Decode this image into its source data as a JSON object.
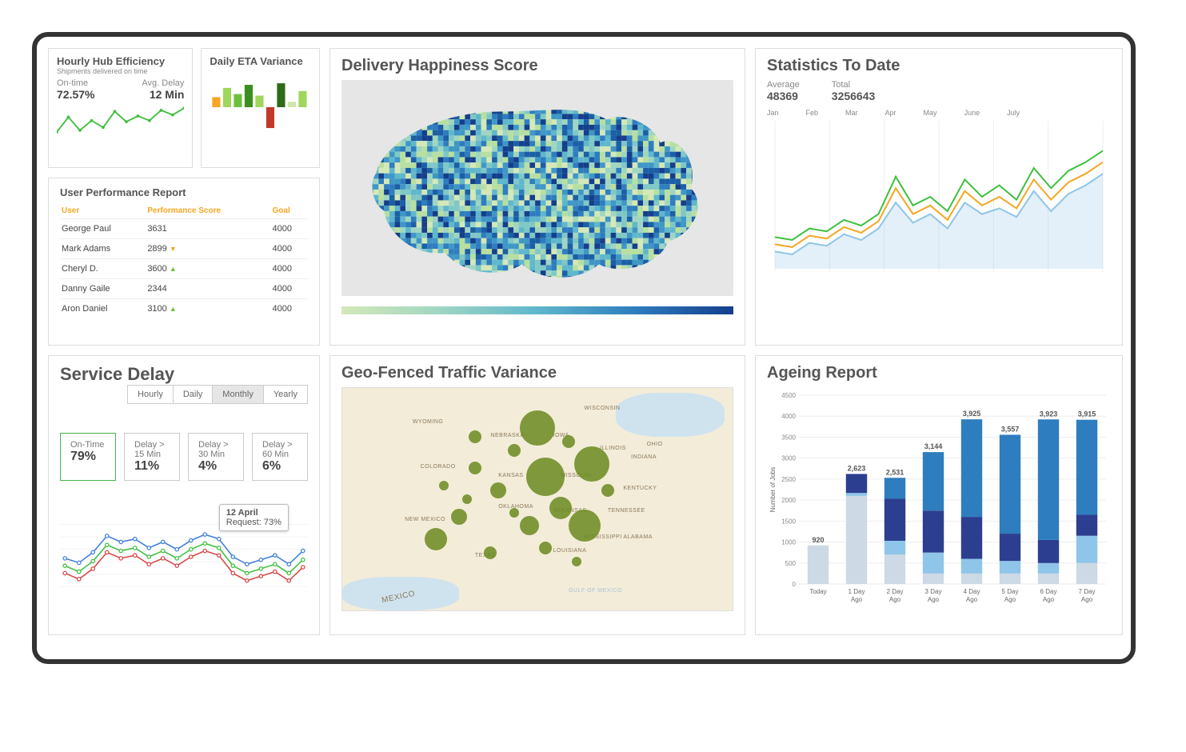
{
  "hub_efficiency": {
    "title": "Hourly Hub Efficiency",
    "subtitle": "Shipments delivered on time",
    "on_time_label": "On-time",
    "on_time_value": "72.57%",
    "avg_delay_label": "Avg. Delay",
    "avg_delay_value": "12 Min"
  },
  "eta_variance": {
    "title": "Daily ETA Variance"
  },
  "performance": {
    "title": "User Performance Report",
    "headers": {
      "user": "User",
      "score": "Performance Score",
      "goal": "Goal"
    },
    "rows": [
      {
        "user": "George Paul",
        "score": "3631",
        "trend": "",
        "goal": "4000"
      },
      {
        "user": "Mark Adams",
        "score": "2899",
        "trend": "down",
        "goal": "4000"
      },
      {
        "user": "Cheryl D.",
        "score": "3600",
        "trend": "up",
        "goal": "4000"
      },
      {
        "user": "Danny Gaile",
        "score": "2344",
        "trend": "",
        "goal": "4000"
      },
      {
        "user": "Aron Daniel",
        "score": "3100",
        "trend": "up",
        "goal": "4000"
      }
    ]
  },
  "happiness": {
    "title": "Delivery Happiness Score"
  },
  "statistics": {
    "title": "Statistics To Date",
    "avg_label": "Average",
    "avg_value": "48369",
    "total_label": "Total",
    "total_value": "3256643",
    "months": [
      "Jan",
      "Feb",
      "Mar",
      "Apr",
      "May",
      "June",
      "July"
    ]
  },
  "service_delay": {
    "title": "Service Delay",
    "tabs": [
      "Hourly",
      "Daily",
      "Monthly",
      "Yearly"
    ],
    "active_tab": "Monthly",
    "cards": [
      {
        "label": "On-Time",
        "value": "79%",
        "active": true
      },
      {
        "label": "Delay > 15 Min",
        "value": "11%"
      },
      {
        "label": "Delay > 30 Min",
        "value": "4%"
      },
      {
        "label": "Delay > 60 Min",
        "value": "6%"
      }
    ],
    "tooltip": {
      "title": "12 April",
      "sub": "Request: 73%"
    }
  },
  "geo": {
    "title": "Geo-Fenced Traffic Variance"
  },
  "ageing": {
    "title": "Ageing Report",
    "ylabel": "Number of Jobs"
  },
  "chart_data": [
    {
      "id": "hub_sparkline",
      "type": "line",
      "values": [
        52,
        78,
        55,
        72,
        60,
        88,
        70,
        80,
        72,
        90,
        82,
        94
      ],
      "color": "#3fbf3f"
    },
    {
      "id": "eta_variance_bars",
      "type": "bar",
      "values": [
        26,
        50,
        34,
        58,
        30,
        -54,
        62,
        14,
        42
      ],
      "colors": [
        "#f5a623",
        "#9fd65c",
        "#6fbf3f",
        "#3b8f1f",
        "#9fd65c",
        "#c0392b",
        "#2e6b16",
        "#cde8a8",
        "#9fd65c"
      ]
    },
    {
      "id": "statistics_lines",
      "type": "line",
      "x_labels": [
        "Jan",
        "Feb",
        "Mar",
        "Apr",
        "May",
        "June",
        "July"
      ],
      "series": [
        {
          "name": "green",
          "color": "#3fbf3f",
          "values": [
            22,
            20,
            28,
            26,
            34,
            30,
            38,
            64,
            44,
            50,
            40,
            62,
            50,
            58,
            48,
            70,
            56,
            68,
            74,
            82
          ]
        },
        {
          "name": "orange",
          "color": "#f5a623",
          "values": [
            17,
            15,
            23,
            21,
            29,
            25,
            33,
            56,
            38,
            44,
            34,
            54,
            44,
            50,
            42,
            62,
            48,
            60,
            66,
            74
          ]
        },
        {
          "name": "blue",
          "color": "#8fc5e8",
          "values": [
            12,
            10,
            18,
            16,
            24,
            20,
            28,
            46,
            32,
            38,
            28,
            46,
            38,
            42,
            36,
            54,
            40,
            52,
            58,
            66
          ]
        }
      ],
      "ylim": [
        0,
        100
      ]
    },
    {
      "id": "service_delay_lines",
      "type": "line",
      "series": [
        {
          "name": "blue",
          "color": "#3f7fdc",
          "values": [
            48,
            42,
            56,
            78,
            70,
            74,
            62,
            70,
            60,
            72,
            80,
            74,
            50,
            40,
            46,
            52,
            40,
            58
          ]
        },
        {
          "name": "green",
          "color": "#3fbf3f",
          "values": [
            38,
            30,
            44,
            66,
            58,
            62,
            50,
            58,
            48,
            60,
            68,
            62,
            38,
            28,
            34,
            40,
            28,
            46
          ]
        },
        {
          "name": "red",
          "color": "#d64545",
          "values": [
            28,
            20,
            34,
            56,
            48,
            52,
            40,
            48,
            38,
            50,
            58,
            52,
            28,
            18,
            24,
            30,
            18,
            36
          ]
        }
      ],
      "ylim": [
        0,
        100
      ],
      "tooltip_point_index": 11
    },
    {
      "id": "ageing_report",
      "type": "bar",
      "ylabel": "Number of Jobs",
      "ylim": [
        0,
        4500
      ],
      "y_ticks": [
        0,
        500,
        1000,
        1500,
        2000,
        2500,
        3000,
        3500,
        4000,
        4500
      ],
      "categories": [
        "Today",
        "1 Day Ago",
        "2 Day Ago",
        "3 Day Ago",
        "4 Day Ago",
        "5 Day Ago",
        "6 Day Ago",
        "7 Day Ago"
      ],
      "totals": [
        920,
        2623,
        2531,
        3144,
        3925,
        3557,
        3923,
        3915
      ],
      "series": [
        {
          "name": "seg1",
          "color": "#cdd9e4",
          "values": [
            920,
            2100,
            700,
            250,
            250,
            250,
            250,
            500
          ]
        },
        {
          "name": "seg2",
          "color": "#8fc5e8",
          "values": [
            0,
            70,
            330,
            500,
            350,
            300,
            250,
            650
          ]
        },
        {
          "name": "seg3",
          "color": "#2c3e8f",
          "values": [
            0,
            453,
            1001,
            1000,
            1000,
            650,
            550,
            500
          ]
        },
        {
          "name": "seg4",
          "color": "#2e7dbf",
          "values": [
            0,
            0,
            500,
            1394,
            2325,
            2357,
            2873,
            2265
          ]
        }
      ]
    },
    {
      "id": "geo_bubbles",
      "type": "scatter",
      "note": "x,y as % of map box; r in px",
      "points": [
        {
          "x": 50,
          "y": 18,
          "r": 22
        },
        {
          "x": 52,
          "y": 40,
          "r": 24
        },
        {
          "x": 64,
          "y": 34,
          "r": 22
        },
        {
          "x": 56,
          "y": 54,
          "r": 14
        },
        {
          "x": 48,
          "y": 62,
          "r": 12
        },
        {
          "x": 62,
          "y": 62,
          "r": 20
        },
        {
          "x": 40,
          "y": 46,
          "r": 10
        },
        {
          "x": 34,
          "y": 36,
          "r": 8
        },
        {
          "x": 30,
          "y": 58,
          "r": 10
        },
        {
          "x": 24,
          "y": 68,
          "r": 14
        },
        {
          "x": 38,
          "y": 74,
          "r": 8
        },
        {
          "x": 34,
          "y": 22,
          "r": 8
        },
        {
          "x": 44,
          "y": 28,
          "r": 8
        },
        {
          "x": 58,
          "y": 24,
          "r": 8
        },
        {
          "x": 68,
          "y": 46,
          "r": 8
        },
        {
          "x": 52,
          "y": 72,
          "r": 8
        },
        {
          "x": 60,
          "y": 78,
          "r": 6
        },
        {
          "x": 44,
          "y": 56,
          "r": 6
        },
        {
          "x": 26,
          "y": 44,
          "r": 6
        },
        {
          "x": 32,
          "y": 50,
          "r": 6
        }
      ]
    }
  ]
}
